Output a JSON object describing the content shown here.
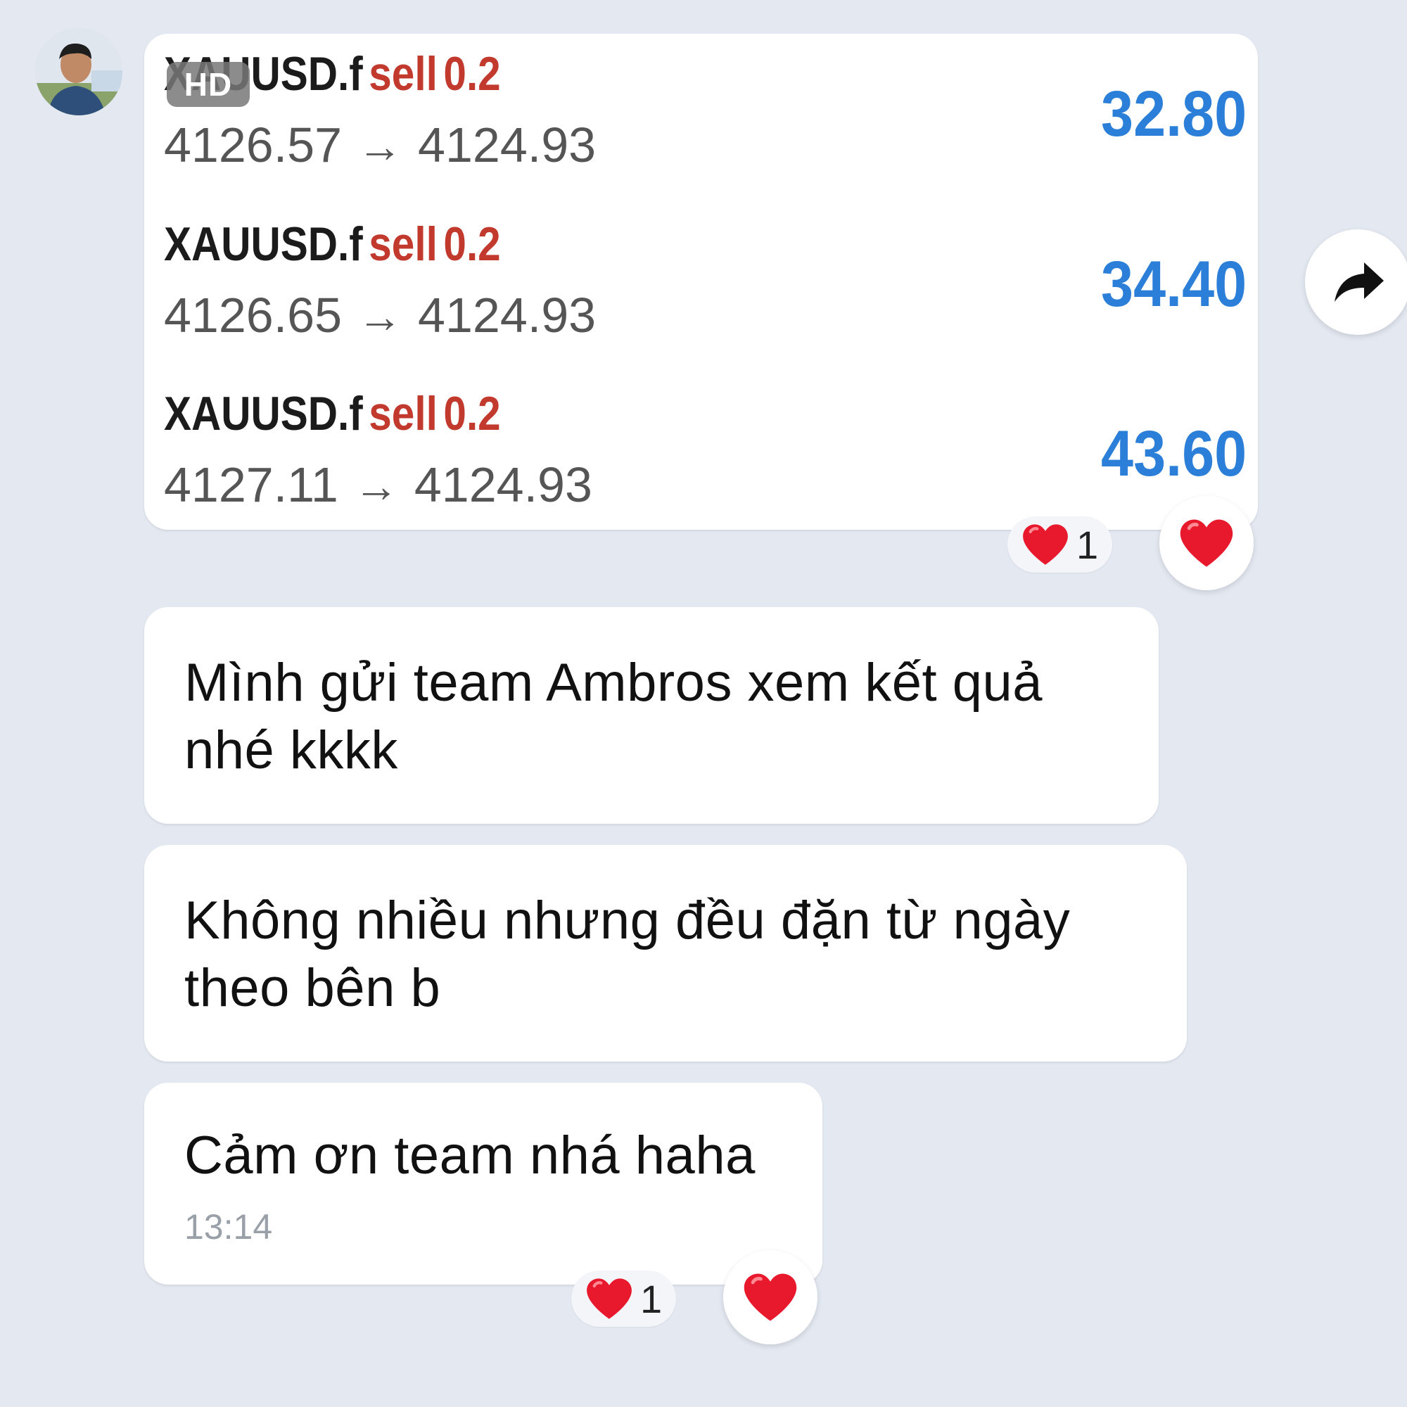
{
  "avatar": {
    "icon": "user-avatar"
  },
  "image_message": {
    "badge": "HD",
    "trades": [
      {
        "symbol": "XAUUSD.f",
        "side": "sell",
        "lot": "0.2",
        "open": "4126.57",
        "arrow": "→",
        "close": "4124.93",
        "profit": "32.80"
      },
      {
        "symbol": "XAUUSD.f",
        "side": "sell",
        "lot": "0.2",
        "open": "4126.65",
        "arrow": "→",
        "close": "4124.93",
        "profit": "34.40"
      },
      {
        "symbol": "XAUUSD.f",
        "side": "sell",
        "lot": "0.2",
        "open": "4127.11",
        "arrow": "→",
        "close": "4124.93",
        "profit": "43.60"
      }
    ],
    "reaction": {
      "emoji": "heart-icon",
      "count": "1"
    }
  },
  "share": {
    "icon": "share-arrow-icon"
  },
  "messages": [
    {
      "text": "Mình gửi team Ambros xem kết quả nhé kkkk"
    },
    {
      "text": "Không nhiều nhưng đều đặn từ ngày theo bên b"
    },
    {
      "text": "Cảm ơn team nhá haha",
      "time": "13:14",
      "reaction": {
        "emoji": "heart-icon",
        "count": "1"
      }
    }
  ],
  "colors": {
    "background": "#e3e8f1",
    "bubble": "#ffffff",
    "sell": "#c23a2e",
    "profit": "#2b7fd8",
    "heart": "#e8192c"
  }
}
